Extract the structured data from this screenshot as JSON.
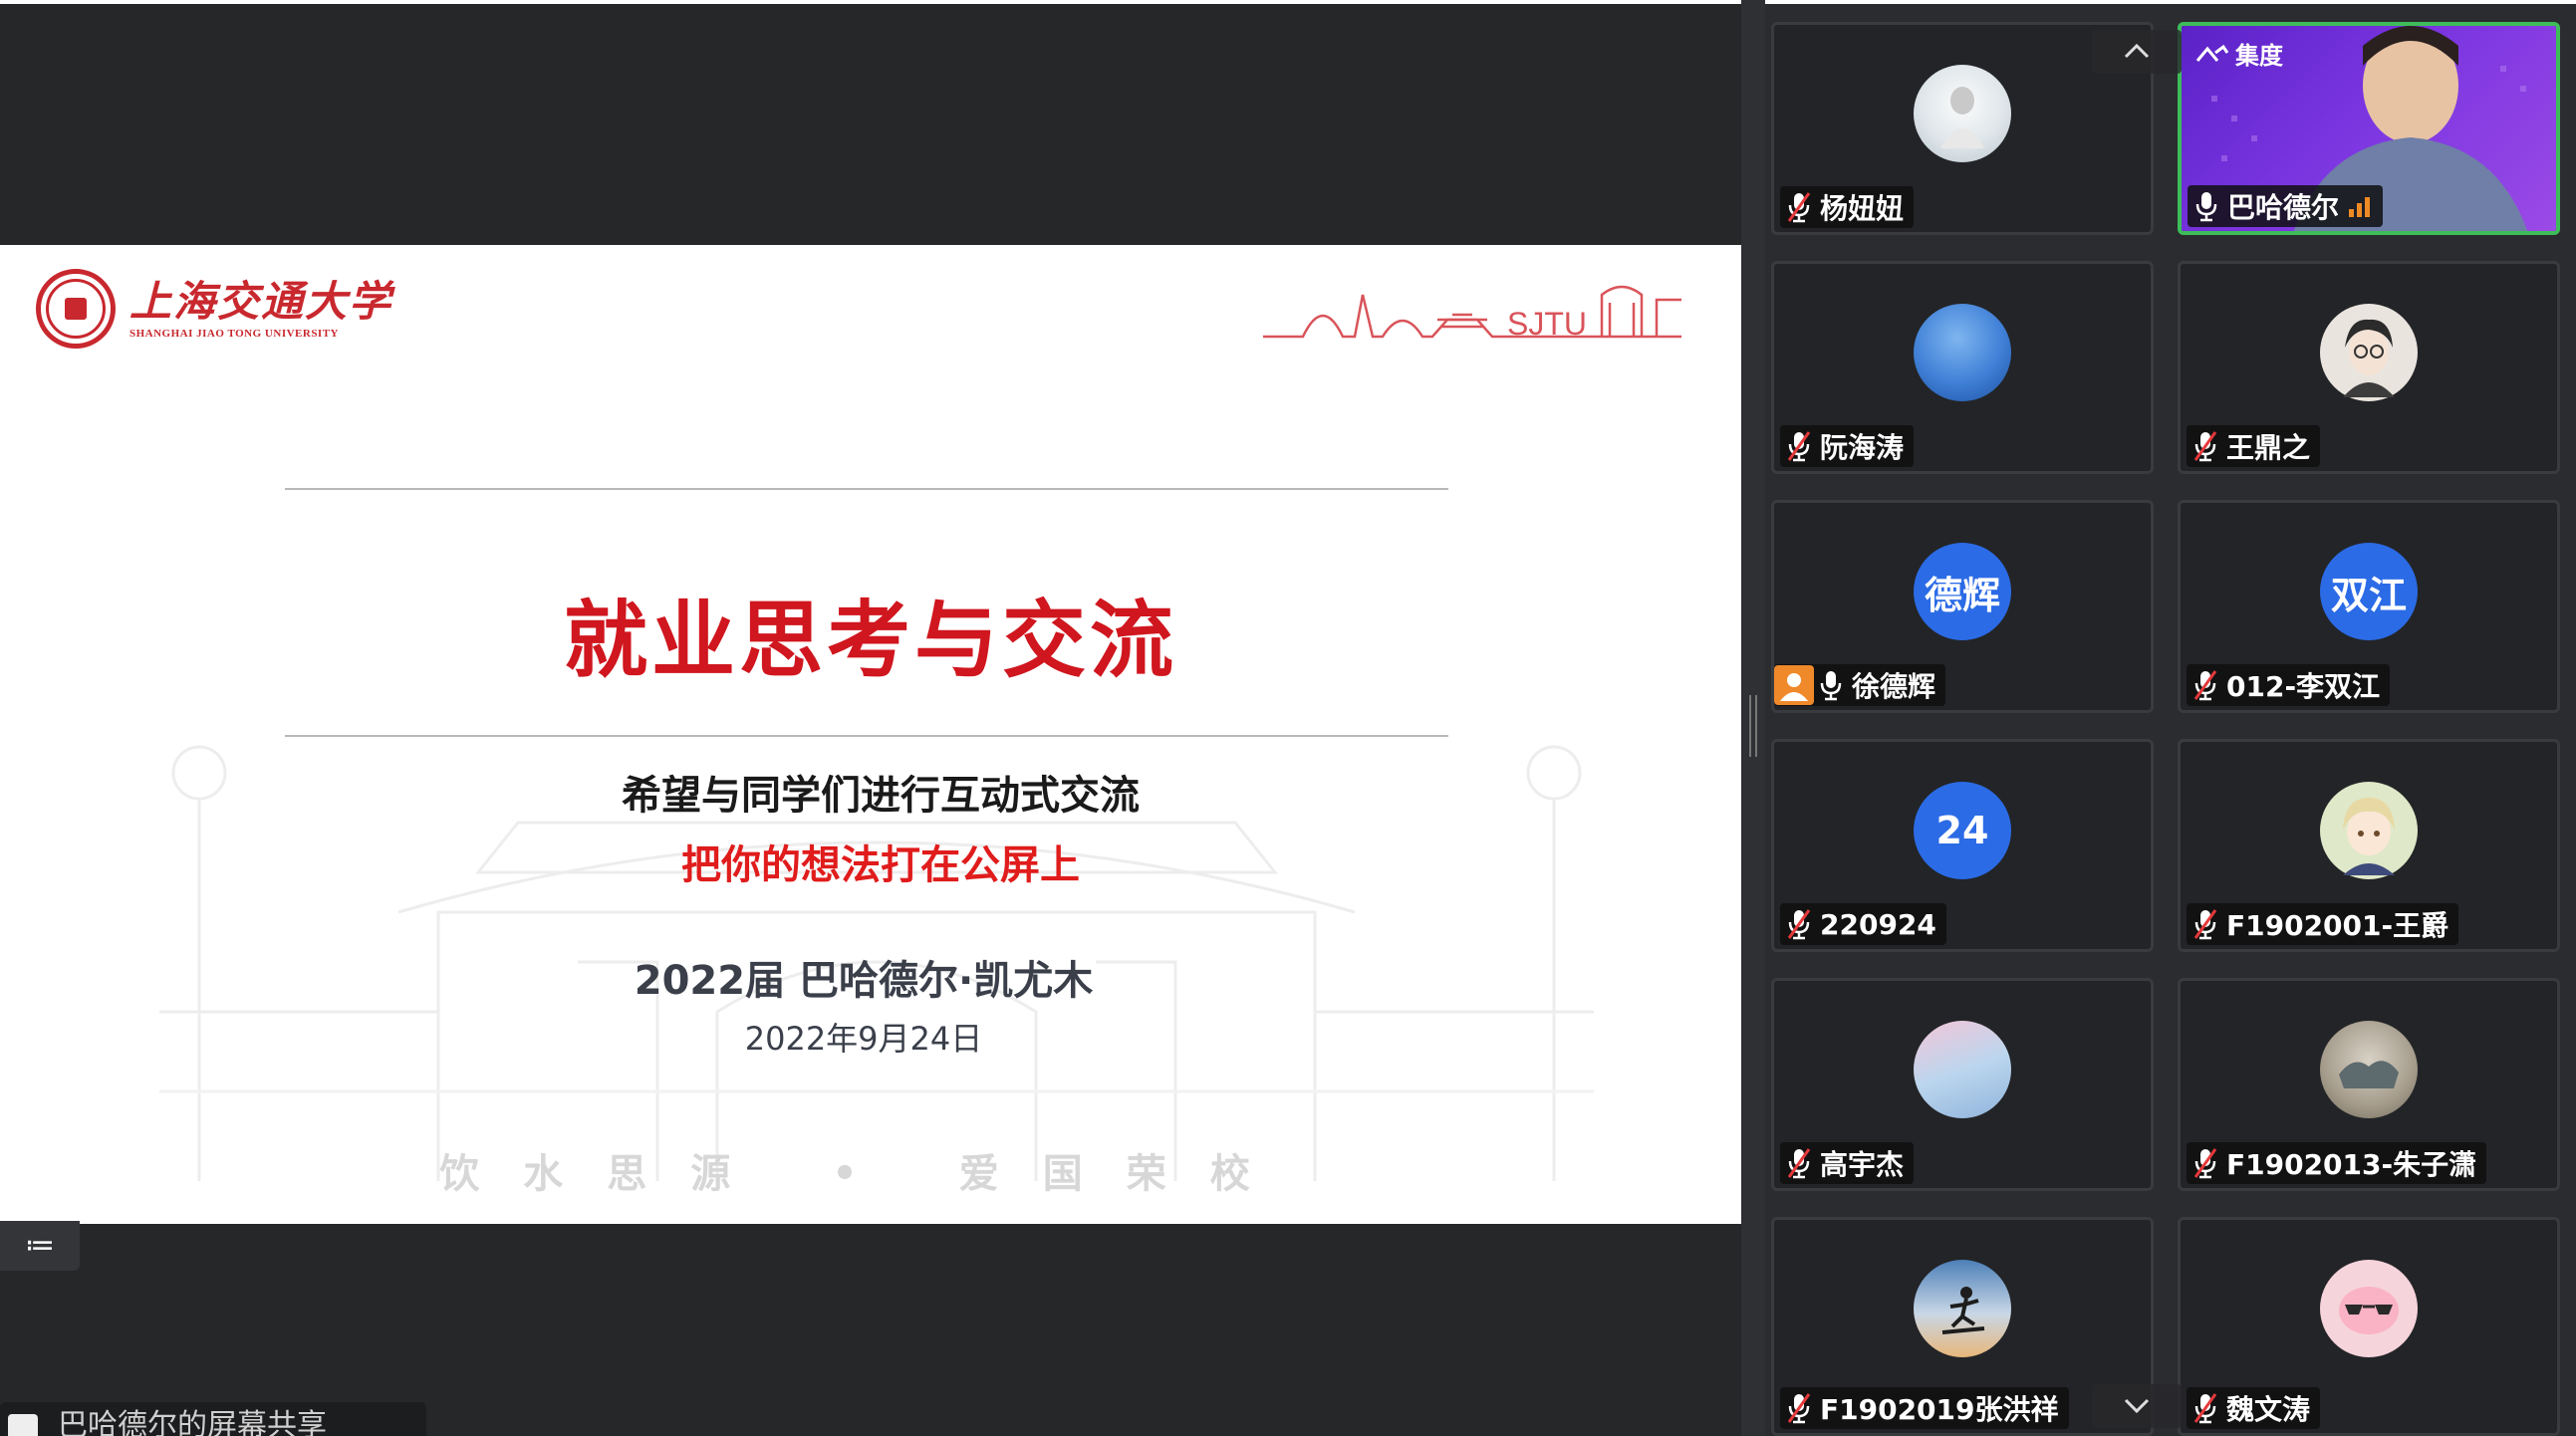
{
  "slide": {
    "logo_cn": "上海交通大学",
    "logo_en": "SHANGHAI JIAO TONG UNIVERSITY",
    "skyline_label": "SJTU",
    "title": "就业思考与交流",
    "subtitle": "希望与同学们进行互动式交流",
    "call_to_action": "把你的想法打在公屏上",
    "author": "2022届 巴哈德尔·凯尤木",
    "date": "2022年9月24日",
    "motto": "饮水思源 • 爱国荣校"
  },
  "toolbar": {
    "list_icon": "≔",
    "presenter_label": "巴哈德尔的屏幕共享"
  },
  "participants": [
    {
      "name": "杨妞妞",
      "avatar": "photo",
      "mic": "off"
    },
    {
      "name": "巴哈德尔",
      "avatar": "video",
      "mic": "on",
      "speaking": true,
      "brand": "集度"
    },
    {
      "name": "阮海涛",
      "avatar": "photo",
      "mic": "off"
    },
    {
      "name": "王鼎之",
      "avatar": "photo",
      "mic": "off"
    },
    {
      "name": "徐德辉",
      "avatar_text": "德辉",
      "mic": "on",
      "host": true
    },
    {
      "name": "012-李双江",
      "avatar_text": "双江",
      "mic": "off"
    },
    {
      "name": "220924",
      "avatar_text": "24",
      "mic": "off"
    },
    {
      "name": "F1902001-王爵",
      "avatar": "photo",
      "mic": "off"
    },
    {
      "name": "高宇杰",
      "avatar": "photo",
      "mic": "off"
    },
    {
      "name": "F1902013-朱子潇",
      "avatar": "photo",
      "mic": "off"
    },
    {
      "name": "F1902019张洪祥",
      "avatar": "photo",
      "mic": "off"
    },
    {
      "name": "魏文涛",
      "avatar": "photo",
      "mic": "off"
    }
  ],
  "colors": {
    "brand_red": "#d0161e",
    "accent_red": "#e01c1c",
    "speaking_green": "#3dbd5a",
    "avatar_blue": "#2b6be6",
    "host_orange": "#f0892a"
  },
  "icons": {
    "mic_off": "mic-off-icon",
    "mic_on": "mic-icon",
    "chevron_up": "chevron-up-icon",
    "chevron_down": "chevron-down-icon",
    "signal": "signal-icon",
    "host": "host-icon",
    "list": "list-icon"
  }
}
